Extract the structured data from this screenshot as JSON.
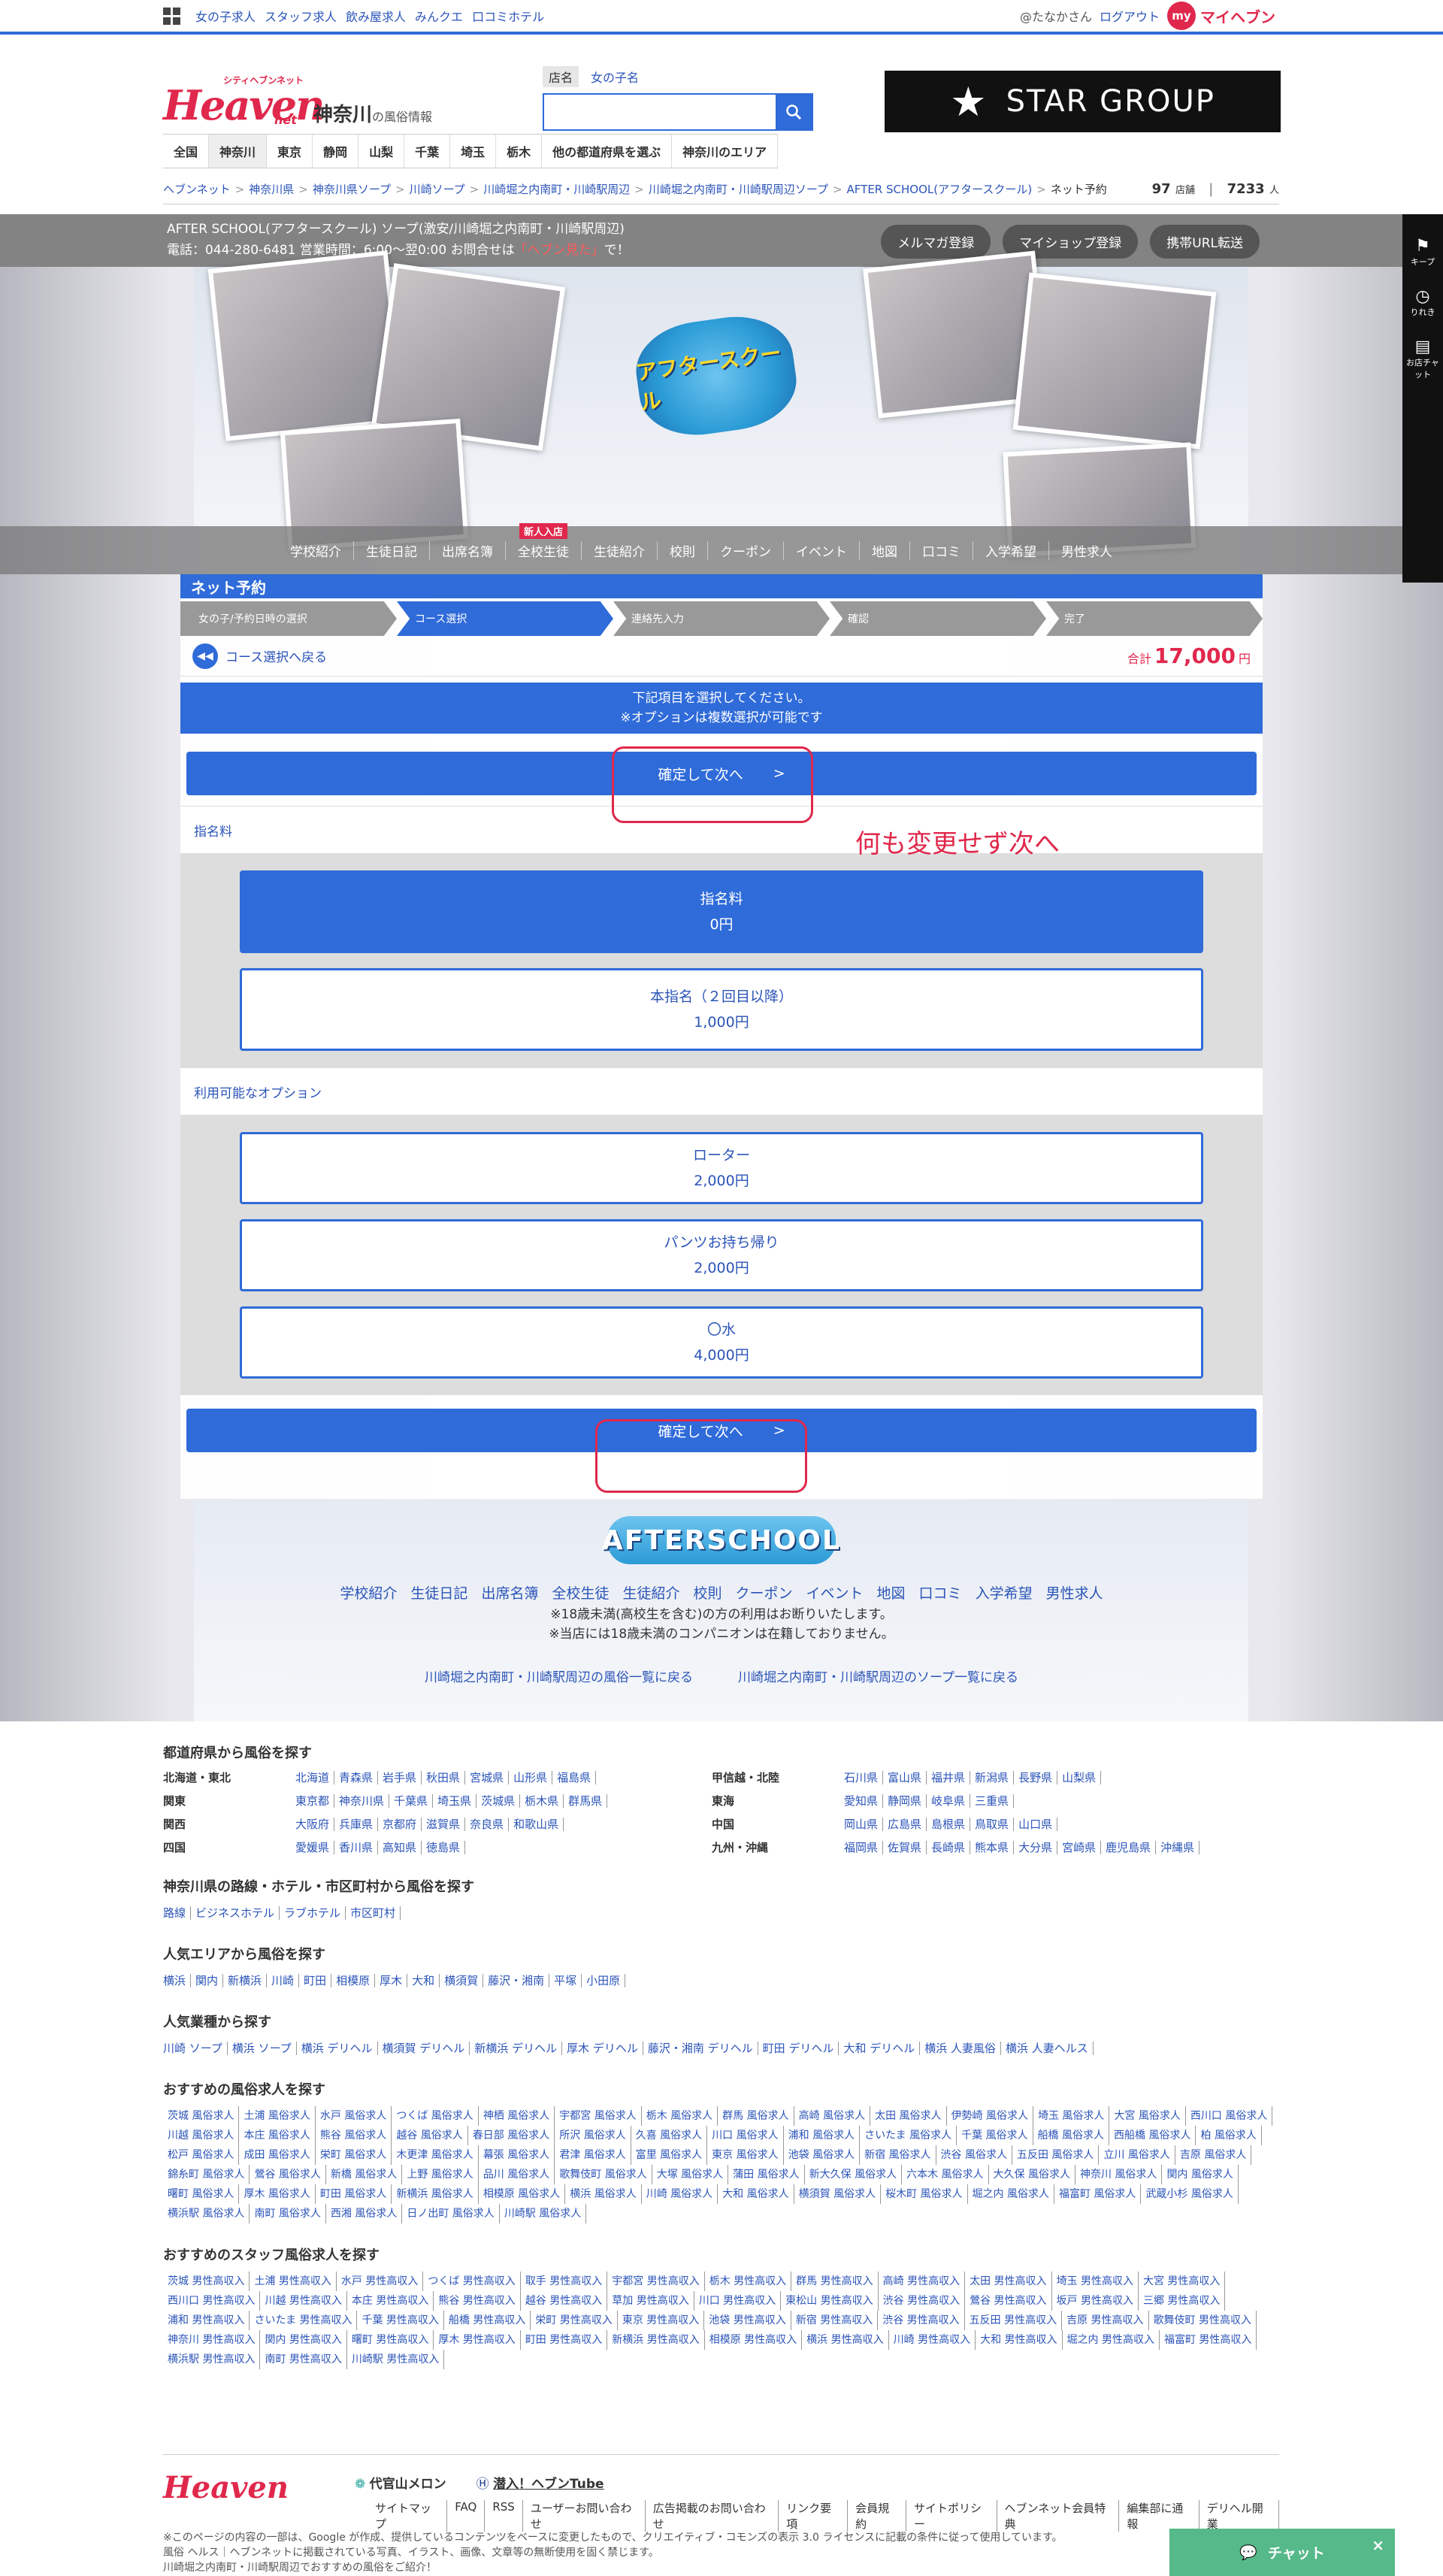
{
  "topbar": {
    "links": [
      "女の子求人",
      "スタッフ求人",
      "飲み屋求人",
      "みんクエ",
      "口コミホテル"
    ],
    "user": "@たなかさん",
    "logout": "ログアウト",
    "my_badge": "my",
    "myheaven": "マイヘブン"
  },
  "header": {
    "logo_sub": "シティヘブンネット",
    "logo_main": "Heaven",
    "logo_net": "net",
    "region": "神奈川",
    "region_sub": "の風俗情報",
    "search_tab_shop": "店名",
    "search_tab_girl": "女の子名",
    "banner": "STAR GROUP",
    "nav": [
      "全国",
      "神奈川",
      "東京",
      "静岡",
      "山梨",
      "千葉",
      "埼玉",
      "栃木",
      "他の都道府県を選ぶ",
      "神奈川のエリア"
    ]
  },
  "breadcrumb": {
    "items": [
      "ヘブンネット",
      "神奈川県",
      "神奈川県ソープ",
      "川崎ソープ",
      "川崎堀之内南町・川崎駅周辺",
      "川崎堀之内南町・川崎駅周辺ソープ",
      "AFTER SCHOOL(アフタースクール)",
      "ネット予約"
    ],
    "shop_count": "97",
    "shop_unit": "店舗",
    "people_count": "7233",
    "people_unit": "人"
  },
  "shopbar": {
    "name": "AFTER SCHOOL(アフタースクール) ソープ(激安/川崎堀之内南町・川崎駅周辺)",
    "tel_prefix": "電話：044-280-6481 営業時間：6:00〜翌0:00 お問合せは",
    "tel_highlight": "「ヘブン見た」",
    "tel_suffix": "で！",
    "buttons": [
      "メルマガ登録",
      "マイショップ登録",
      "携帯URL転送"
    ]
  },
  "sidebar": {
    "keep": "キープ",
    "history": "りれき",
    "chat": "お店チャット"
  },
  "hero": {
    "logo": "アフタースクール"
  },
  "shopnav": {
    "items": [
      "学校紹介",
      "生徒日記",
      "出席名簿",
      "全校生徒",
      "生徒紹介",
      "校則",
      "クーポン",
      "イベント",
      "地図",
      "口コミ",
      "入学希望",
      "男性求人"
    ],
    "new_badge": "新人入店"
  },
  "reserve": {
    "title": "ネット予約",
    "steps": [
      "女の子/予約日時の選択",
      "コース選択",
      "連絡先入力",
      "確認",
      "完了"
    ],
    "back": "コース選択へ戻る",
    "total_label": "合計",
    "total_value": "17,000",
    "total_unit": "円",
    "notice1": "下記項目を選択してください。",
    "notice2": "※オプションは複数選択が可能です",
    "next": "確定して次へ",
    "next_arrow": ">",
    "annotation": "何も変更せず次へ",
    "section_nomination": "指名料",
    "nomination": [
      {
        "name": "指名料",
        "price": "0円",
        "selected": true
      },
      {
        "name": "本指名（２回目以降）",
        "price": "1,000円",
        "selected": false
      }
    ],
    "section_options": "利用可能なオプション",
    "options": [
      {
        "name": "ローター",
        "price": "2,000円"
      },
      {
        "name": "パンツお持ち帰り",
        "price": "2,000円"
      },
      {
        "name": "〇水",
        "price": "4,000円"
      }
    ]
  },
  "footerband": {
    "logo": "AFTERSCHOOL",
    "links": [
      "学校紹介",
      "生徒日記",
      "出席名簿",
      "全校生徒",
      "生徒紹介",
      "校則",
      "クーポン",
      "イベント",
      "地図",
      "口コミ",
      "入学希望",
      "男性求人"
    ],
    "note1": "※18歳未満(高校生を含む)の方の利用はお断りいたします。",
    "note2": "※当店には18歳未満のコンパニオンは在籍しておりません。",
    "back1": "川崎堀之内南町・川崎駅周辺の風俗一覧に戻る",
    "back2": "川崎堀之内南町・川崎駅周辺のソープ一覧に戻る"
  },
  "lower": {
    "pref_title": "都道府県から風俗を探す",
    "regions": [
      {
        "name": "北海道・東北",
        "prefs": [
          "北海道",
          "青森県",
          "岩手県",
          "秋田県",
          "宮城県",
          "山形県",
          "福島県"
        ]
      },
      {
        "name": "甲信越・北陸",
        "prefs": [
          "石川県",
          "富山県",
          "福井県",
          "新潟県",
          "長野県",
          "山梨県"
        ]
      },
      {
        "name": "関東",
        "prefs": [
          "東京都",
          "神奈川県",
          "千葉県",
          "埼玉県",
          "茨城県",
          "栃木県",
          "群馬県"
        ]
      },
      {
        "name": "東海",
        "prefs": [
          "愛知県",
          "静岡県",
          "岐阜県",
          "三重県"
        ]
      },
      {
        "name": "関西",
        "prefs": [
          "大阪府",
          "兵庫県",
          "京都府",
          "滋賀県",
          "奈良県",
          "和歌山県"
        ]
      },
      {
        "name": "中国",
        "prefs": [
          "岡山県",
          "広島県",
          "島根県",
          "鳥取県",
          "山口県"
        ]
      },
      {
        "name": "四国",
        "prefs": [
          "愛媛県",
          "香川県",
          "高知県",
          "徳島県"
        ]
      },
      {
        "name": "九州・沖縄",
        "prefs": [
          "福岡県",
          "佐賀県",
          "長崎県",
          "熊本県",
          "大分県",
          "宮崎県",
          "鹿児島県",
          "沖縄県"
        ]
      }
    ],
    "route_title": "神奈川県の路線・ホテル・市区町村から風俗を探す",
    "route_links": [
      "路線",
      "ビジネスホテル",
      "ラブホテル",
      "市区町村"
    ],
    "area_title": "人気エリアから風俗を探す",
    "area_links": [
      "横浜",
      "関内",
      "新横浜",
      "川崎",
      "町田",
      "相模原",
      "厚木",
      "大和",
      "横須賀",
      "藤沢・湘南",
      "平塚",
      "小田原"
    ],
    "type_title": "人気業種から探す",
    "type_links": [
      "川崎 ソープ",
      "横浜 ソープ",
      "横浜 デリヘル",
      "横須賀 デリヘル",
      "新横浜 デリヘル",
      "厚木 デリヘル",
      "藤沢・湘南 デリヘル",
      "町田 デリヘル",
      "大和 デリヘル",
      "横浜 人妻風俗",
      "横浜 人妻ヘルス"
    ],
    "job_title": "おすすめの風俗求人を探す",
    "job_links": [
      "茨城 風俗求人",
      "土浦 風俗求人",
      "水戸 風俗求人",
      "つくば 風俗求人",
      "神栖 風俗求人",
      "宇都宮 風俗求人",
      "栃木 風俗求人",
      "群馬 風俗求人",
      "高崎 風俗求人",
      "太田 風俗求人",
      "伊勢崎 風俗求人",
      "埼玉 風俗求人",
      "大宮 風俗求人",
      "西川口 風俗求人",
      "川越 風俗求人",
      "本庄 風俗求人",
      "熊谷 風俗求人",
      "越谷 風俗求人",
      "春日部 風俗求人",
      "所沢 風俗求人",
      "久喜 風俗求人",
      "川口 風俗求人",
      "浦和 風俗求人",
      "さいたま 風俗求人",
      "千葉 風俗求人",
      "船橋 風俗求人",
      "西船橋 風俗求人",
      "柏 風俗求人",
      "松戸 風俗求人",
      "成田 風俗求人",
      "栄町 風俗求人",
      "木更津 風俗求人",
      "幕張 風俗求人",
      "君津 風俗求人",
      "富里 風俗求人",
      "東京 風俗求人",
      "池袋 風俗求人",
      "新宿 風俗求人",
      "渋谷 風俗求人",
      "五反田 風俗求人",
      "立川 風俗求人",
      "吉原 風俗求人",
      "錦糸町 風俗求人",
      "鶯谷 風俗求人",
      "新橋 風俗求人",
      "上野 風俗求人",
      "品川 風俗求人",
      "歌舞伎町 風俗求人",
      "大塚 風俗求人",
      "蒲田 風俗求人",
      "新大久保 風俗求人",
      "六本木 風俗求人",
      "大久保 風俗求人",
      "神奈川 風俗求人",
      "関内 風俗求人",
      "曙町 風俗求人",
      "厚木 風俗求人",
      "町田 風俗求人",
      "新横浜 風俗求人",
      "相模原 風俗求人",
      "横浜 風俗求人",
      "川崎 風俗求人",
      "大和 風俗求人",
      "横須賀 風俗求人",
      "桜木町 風俗求人",
      "堀之内 風俗求人",
      "福富町 風俗求人",
      "武蔵小杉 風俗求人",
      "横浜駅 風俗求人",
      "南町 風俗求人",
      "西湘 風俗求人",
      "日ノ出町 風俗求人",
      "川崎駅 風俗求人"
    ],
    "staff_title": "おすすめのスタッフ風俗求人を探す",
    "staff_links": [
      "茨城 男性高収入",
      "土浦 男性高収入",
      "水戸 男性高収入",
      "つくば 男性高収入",
      "取手 男性高収入",
      "宇都宮 男性高収入",
      "栃木 男性高収入",
      "群馬 男性高収入",
      "高崎 男性高収入",
      "太田 男性高収入",
      "埼玉 男性高収入",
      "大宮 男性高収入",
      "西川口 男性高収入",
      "川越 男性高収入",
      "本庄 男性高収入",
      "熊谷 男性高収入",
      "越谷 男性高収入",
      "草加 男性高収入",
      "川口 男性高収入",
      "東松山 男性高収入",
      "渋谷 男性高収入",
      "鶯谷 男性高収入",
      "坂戸 男性高収入",
      "三郷 男性高収入",
      "浦和 男性高収入",
      "さいたま 男性高収入",
      "千葉 男性高収入",
      "船橋 男性高収入",
      "栄町 男性高収入",
      "東京 男性高収入",
      "池袋 男性高収入",
      "新宿 男性高収入",
      "渋谷 男性高収入",
      "五反田 男性高収入",
      "吉原 男性高収入",
      "歌舞伎町 男性高収入",
      "神奈川 男性高収入",
      "関内 男性高収入",
      "曙町 男性高収入",
      "厚木 男性高収入",
      "町田 男性高収入",
      "新横浜 男性高収入",
      "相模原 男性高収入",
      "横浜 男性高収入",
      "川崎 男性高収入",
      "大和 男性高収入",
      "堀之内 男性高収入",
      "福富町 男性高収入",
      "横浜駅 男性高収入",
      "南町 男性高収入",
      "川崎駅 男性高収入"
    ]
  },
  "bottom": {
    "logo": "Heaven",
    "partner1": "代官山メロン",
    "partner2": "潜入！ヘブンTube",
    "links": [
      "サイトマップ",
      "FAQ",
      "RSS",
      "ユーザーお問い合わせ",
      "広告掲載のお問い合わせ",
      "リンク要項",
      "会員規約",
      "サイトポリシー",
      "ヘブンネット会員特典",
      "編集部に通報",
      "デリヘル開業"
    ],
    "copy1": "※このページの内容の一部は、Google が作成、提供しているコンテンツをベースに変更したもので、クリエイティブ・コモンズの表示 3.0 ライセンスに記載の条件に従って使用しています。",
    "copy2": "風俗 ヘルス｜ヘブンネットに掲載されている写真、イラスト、画像、文章等の無断使用を固く禁じます。",
    "copy3": "川崎堀之内南町・川崎駅周辺でおすすめの風俗をご紹介！"
  },
  "chat": {
    "label": "チャット",
    "close": "×"
  }
}
